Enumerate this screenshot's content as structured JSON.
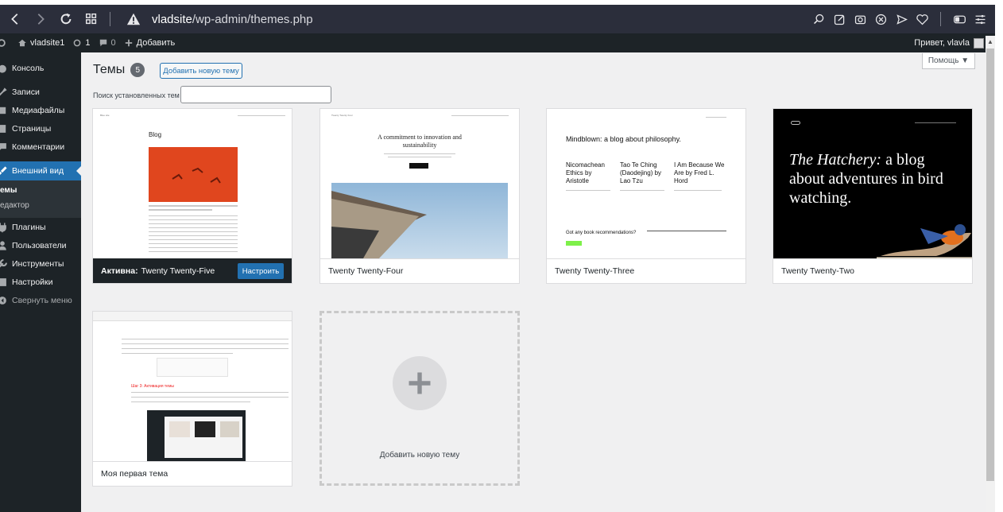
{
  "browser": {
    "url_host": "vladsite",
    "url_path": "/wp-admin/themes.php"
  },
  "adminbar": {
    "site_name": "vladsite1",
    "updates_count": "1",
    "comments_count": "0",
    "new_label": "Добавить",
    "greeting": "Привет, vlavla"
  },
  "sidebar": {
    "items": [
      {
        "label": "Консоль",
        "icon": "dashboard-icon"
      },
      {
        "label": "Записи",
        "icon": "pin-icon"
      },
      {
        "label": "Медиафайлы",
        "icon": "media-icon"
      },
      {
        "label": "Страницы",
        "icon": "page-icon"
      },
      {
        "label": "Комментарии",
        "icon": "comment-icon"
      },
      {
        "label": "Внешний вид",
        "icon": "brush-icon"
      },
      {
        "label": "Плагины",
        "icon": "plugin-icon"
      },
      {
        "label": "Пользователи",
        "icon": "users-icon"
      },
      {
        "label": "Инструменты",
        "icon": "wrench-icon"
      },
      {
        "label": "Настройки",
        "icon": "settings-icon"
      },
      {
        "label": "Свернуть меню",
        "icon": "collapse-icon"
      }
    ],
    "submenu": [
      "емы",
      "едактор"
    ]
  },
  "help_label": "Помощь ▼",
  "page": {
    "title": "Темы",
    "count": "5",
    "add_new_label": "Добавить новую тему",
    "search_label": "Поиск установленных тем"
  },
  "themes": [
    {
      "active_prefix": "Активна:",
      "name": "Twenty Twenty-Five",
      "customize_label": "Настроить",
      "preview_site": "Blue site",
      "preview_heading": "Blog"
    },
    {
      "name": "Twenty Twenty-Four",
      "preview_site": "Twenty Twenty Four",
      "preview_heading": "A commitment to innovation and sustainability"
    },
    {
      "name": "Twenty Twenty-Three",
      "preview_heading": "Mindblown: a blog about philosophy.",
      "preview_cols": [
        "Nicomachean Ethics by Aristotle",
        "Tao Te Ching (Daodejing) by Lao Tzu",
        "I Am Because We Are by Fred L. Hord"
      ],
      "preview_footer": "Got any book recommendations?"
    },
    {
      "name": "Twenty Twenty-Two",
      "preview_heading_italic": "The Hatchery:",
      "preview_heading_rest": " a blog about adventures in bird watching."
    },
    {
      "name": "Моя первая тема",
      "preview_note": "Шаг 3: Активация темы"
    }
  ],
  "add_theme_label": "Добавить новую тему",
  "colors": {
    "wp_blue": "#2271b1",
    "admin_dark": "#1d2327",
    "browser_bar": "#2b2e3b",
    "content_bg": "#f0f0f1"
  }
}
